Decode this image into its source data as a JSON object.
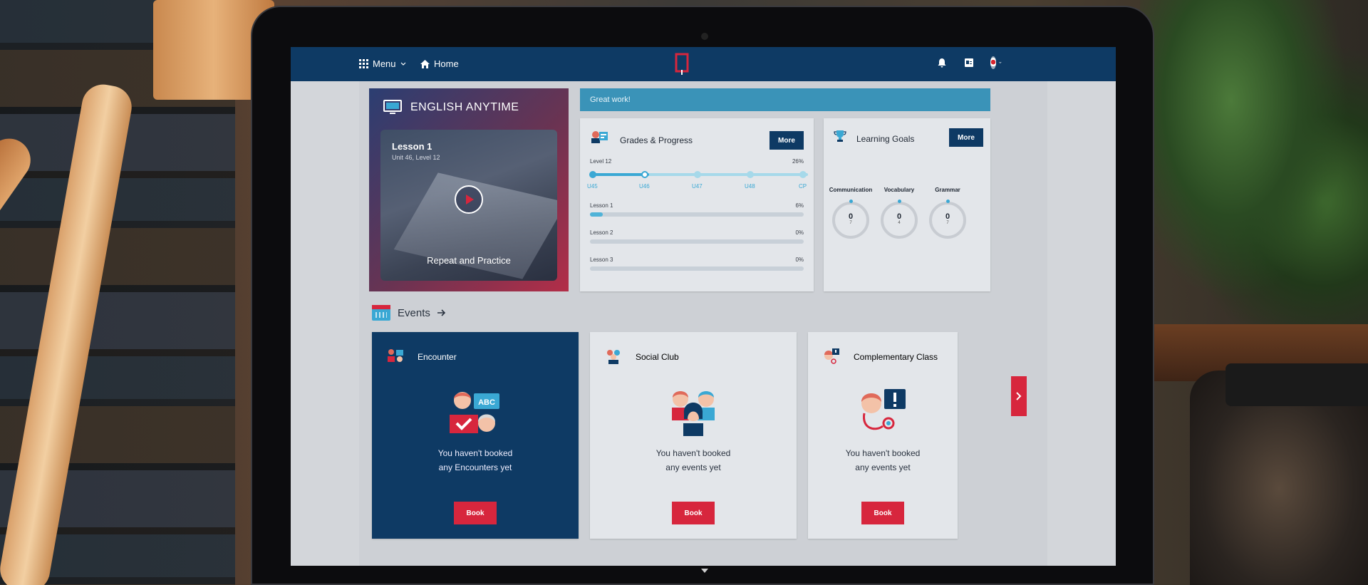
{
  "nav": {
    "menu_label": "Menu",
    "home_label": "Home"
  },
  "english_anytime": {
    "title": "ENGLISH ANYTIME",
    "lesson": "Lesson 1",
    "unit": "Unit 46, Level 12",
    "caption": "Repeat and Practice"
  },
  "banner": {
    "text": "Great work!"
  },
  "grades": {
    "title": "Grades & Progress",
    "more_label": "More",
    "level_label": "Level 12",
    "level_progress": "26%",
    "units": [
      "U45",
      "U46",
      "U47",
      "U48",
      "CP"
    ],
    "lessons": [
      {
        "label": "Lesson 1",
        "value": "6%",
        "fraction": 0.06
      },
      {
        "label": "Lesson 2",
        "value": "0%",
        "fraction": 0
      },
      {
        "label": "Lesson 3",
        "value": "0%",
        "fraction": 0
      }
    ]
  },
  "goals": {
    "title": "Learning Goals",
    "more_label": "More",
    "items": [
      {
        "name": "Communication",
        "value": "0",
        "sub": "7"
      },
      {
        "name": "Vocabulary",
        "value": "0",
        "sub": "4"
      },
      {
        "name": "Grammar",
        "value": "0",
        "sub": "7"
      }
    ]
  },
  "events": {
    "title": "Events",
    "cards": [
      {
        "title": "Encounter",
        "line1": "You haven't booked",
        "line2": "any Encounters yet",
        "book_label": "Book"
      },
      {
        "title": "Social Club",
        "line1": "You haven't booked",
        "line2": "any events yet",
        "book_label": "Book"
      },
      {
        "title": "Complementary Class",
        "line1": "You haven't booked",
        "line2": "any events yet",
        "book_label": "Book"
      }
    ]
  },
  "colors": {
    "navy": "#0e3a64",
    "accent_red": "#d7263d",
    "accent_blue": "#3aa8d4"
  }
}
